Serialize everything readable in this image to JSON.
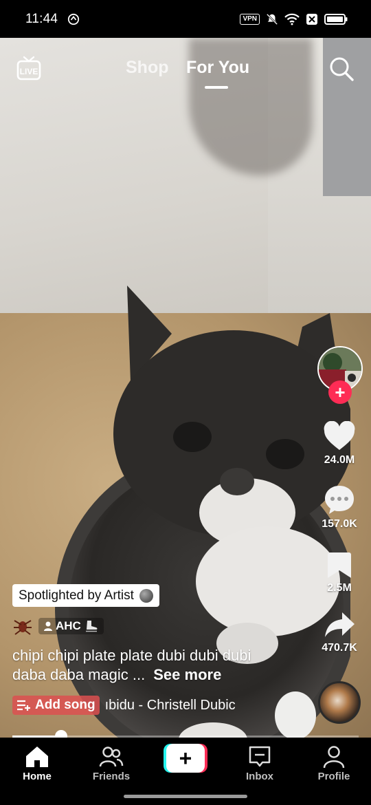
{
  "status_bar": {
    "time": "11:44",
    "vpn_label": "VPN"
  },
  "top_nav": {
    "tabs": [
      {
        "label": "Shop"
      },
      {
        "label": "For You"
      }
    ],
    "active_tab": "For You"
  },
  "video": {
    "spotlight_label": "Spotlighted by Artist",
    "username_chip": "AHC",
    "caption": "chipi chipi plate plate dubi dubi dubi daba daba magic ...",
    "see_more": "See more",
    "add_song": "Add song",
    "music_text": "ıbidu - Christell    Dubic",
    "progress": 0.14
  },
  "actions": {
    "likes": "24.0M",
    "comments": "157.0K",
    "saves": "2.5M",
    "shares": "470.7K"
  },
  "bottom_nav": {
    "home": "Home",
    "friends": "Friends",
    "inbox": "Inbox",
    "profile": "Profile"
  },
  "colors": {
    "accent": "#fe2c55",
    "cyan": "#25f4ee"
  }
}
